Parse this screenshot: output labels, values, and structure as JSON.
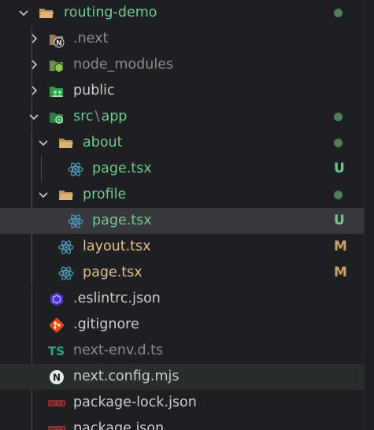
{
  "colors": {
    "background": "#1e1f22",
    "selected_row": "#37373d",
    "hover_row": "#2a2d2e",
    "text": "#cccccc",
    "ignored_text": "#8c8c8c",
    "untracked_green": "#73c991",
    "modified_gold": "#e2c08d",
    "badge_u": "#73c991",
    "badge_m": "#c5a46a",
    "dot": "#4e7f59",
    "react_blue": "#519aba",
    "folder_tan": "#d9b27c"
  },
  "explorer": {
    "root": {
      "label": "routing-demo",
      "icon": "folder-open-icon",
      "expanded": true,
      "dot": true
    },
    "items": [
      {
        "label": ".next",
        "icon": "next-folder-icon",
        "expanded": false,
        "status": "ignored"
      },
      {
        "label": "node_modules",
        "icon": "node-folder-icon",
        "expanded": false,
        "status": "ignored"
      },
      {
        "label": "public",
        "icon": "public-folder-icon",
        "expanded": false,
        "status": "normal"
      },
      {
        "label_part1": "src",
        "label_sep": "\\",
        "label_part2": "app",
        "icon": "app-folder-icon",
        "expanded": true,
        "dot": true
      },
      {
        "label": "about",
        "icon": "folder-open-icon",
        "expanded": true,
        "dot": true
      },
      {
        "label": "page.tsx",
        "icon": "react-icon",
        "badge": "U"
      },
      {
        "label": "profile",
        "icon": "folder-open-icon",
        "expanded": true,
        "dot": true
      },
      {
        "label": "page.tsx",
        "icon": "react-icon",
        "badge": "U",
        "selected": true
      },
      {
        "label": "layout.tsx",
        "icon": "react-icon",
        "badge": "M"
      },
      {
        "label": "page.tsx",
        "icon": "react-icon",
        "badge": "M"
      },
      {
        "label": ".eslintrc.json",
        "icon": "eslint-icon"
      },
      {
        "label": ".gitignore",
        "icon": "git-icon"
      },
      {
        "label": "next-env.d.ts",
        "icon": "typescript-icon",
        "icon_text": "TS",
        "status": "ignored"
      },
      {
        "label": "next.config.mjs",
        "icon": "next-icon",
        "icon_text": "N",
        "hovered": true
      },
      {
        "label": "package-lock.json",
        "icon": "npm-icon"
      },
      {
        "label": "package.json",
        "icon": "npm-icon"
      }
    ]
  }
}
